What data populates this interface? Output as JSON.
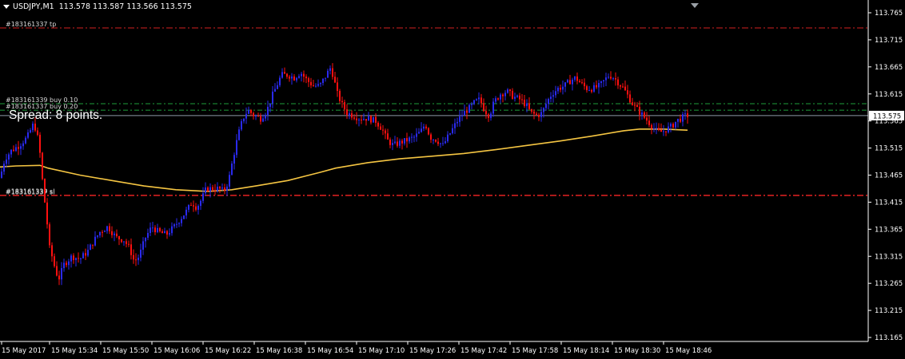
{
  "header": {
    "symbol": "USDJPY,M1",
    "quote": "113.578 113.587 113.566 113.575"
  },
  "spread_text": "Spread: 8 points.",
  "chart_data": {
    "type": "candlestick",
    "symbol": "USDJPY",
    "timeframe": "M1",
    "ylim": [
      113.165,
      113.765
    ],
    "y_ticks": [
      "113.765",
      "113.715",
      "113.665",
      "113.615",
      "113.565",
      "113.515",
      "113.465",
      "113.415",
      "113.365",
      "113.315",
      "113.265",
      "113.215",
      "113.165"
    ],
    "x_ticks": [
      "15 May 2017",
      "15 May 15:34",
      "15 May 15:50",
      "15 May 16:06",
      "15 May 16:22",
      "15 May 16:38",
      "15 May 16:54",
      "15 May 17:10",
      "15 May 17:26",
      "15 May 17:42",
      "15 May 17:58",
      "15 May 18:14",
      "15 May 18:30",
      "15 May 18:46"
    ],
    "current_price": "113.575",
    "colors": {
      "up": "#2a2af0",
      "down": "#ff1010",
      "ma": "#f5c542",
      "tp_sl": "#d42020",
      "order_line": "#1e9e3a",
      "price_line": "#8c99a6",
      "axis": "#ffffff"
    },
    "levels": [
      {
        "label": "#183161337 tp",
        "price": 113.737,
        "kind": "tp"
      },
      {
        "label": "#183161339 buy 0.10",
        "price": 113.597,
        "kind": "order"
      },
      {
        "label": "#183161337 buy 0.20",
        "price": 113.585,
        "kind": "order"
      },
      {
        "label": "#183161339 sl",
        "price": 113.428,
        "kind": "sl"
      },
      {
        "label": "#183161337 sl",
        "price": 113.427,
        "kind": "sl"
      }
    ],
    "price_path": [
      [
        0,
        113.46
      ],
      [
        6,
        113.495
      ],
      [
        14,
        113.51
      ],
      [
        24,
        113.52
      ],
      [
        34,
        113.535
      ],
      [
        42,
        113.56
      ],
      [
        46,
        113.545
      ],
      [
        50,
        113.505
      ],
      [
        54,
        113.44
      ],
      [
        58,
        113.39
      ],
      [
        62,
        113.33
      ],
      [
        66,
        113.31
      ],
      [
        70,
        113.285
      ],
      [
        74,
        113.275
      ],
      [
        80,
        113.3
      ],
      [
        90,
        113.315
      ],
      [
        100,
        113.31
      ],
      [
        110,
        113.325
      ],
      [
        118,
        113.345
      ],
      [
        125,
        113.36
      ],
      [
        135,
        113.37
      ],
      [
        145,
        113.35
      ],
      [
        155,
        113.345
      ],
      [
        162,
        113.33
      ],
      [
        168,
        113.305
      ],
      [
        174,
        113.315
      ],
      [
        182,
        113.35
      ],
      [
        190,
        113.37
      ],
      [
        198,
        113.36
      ],
      [
        208,
        113.355
      ],
      [
        218,
        113.37
      ],
      [
        226,
        113.385
      ],
      [
        234,
        113.4
      ],
      [
        240,
        113.415
      ],
      [
        246,
        113.405
      ],
      [
        252,
        113.42
      ],
      [
        258,
        113.44
      ],
      [
        266,
        113.44
      ],
      [
        274,
        113.44
      ],
      [
        280,
        113.435
      ],
      [
        286,
        113.455
      ],
      [
        292,
        113.5
      ],
      [
        298,
        113.54
      ],
      [
        304,
        113.57
      ],
      [
        310,
        113.585
      ],
      [
        318,
        113.575
      ],
      [
        326,
        113.57
      ],
      [
        334,
        113.585
      ],
      [
        340,
        113.61
      ],
      [
        346,
        113.63
      ],
      [
        352,
        113.65
      ],
      [
        360,
        113.65
      ],
      [
        368,
        113.645
      ],
      [
        376,
        113.655
      ],
      [
        384,
        113.64
      ],
      [
        392,
        113.63
      ],
      [
        400,
        113.63
      ],
      [
        408,
        113.65
      ],
      [
        414,
        113.665
      ],
      [
        418,
        113.64
      ],
      [
        422,
        113.615
      ],
      [
        428,
        113.595
      ],
      [
        434,
        113.58
      ],
      [
        442,
        113.575
      ],
      [
        450,
        113.57
      ],
      [
        460,
        113.57
      ],
      [
        470,
        113.565
      ],
      [
        478,
        113.55
      ],
      [
        484,
        113.53
      ],
      [
        492,
        113.52
      ],
      [
        500,
        113.525
      ],
      [
        510,
        113.53
      ],
      [
        518,
        113.535
      ],
      [
        526,
        113.545
      ],
      [
        532,
        113.56
      ],
      [
        538,
        113.535
      ],
      [
        546,
        113.53
      ],
      [
        554,
        113.52
      ],
      [
        560,
        113.535
      ],
      [
        566,
        113.55
      ],
      [
        572,
        113.565
      ],
      [
        580,
        113.58
      ],
      [
        588,
        113.59
      ],
      [
        594,
        113.6
      ],
      [
        600,
        113.605
      ],
      [
        606,
        113.585
      ],
      [
        612,
        113.575
      ],
      [
        618,
        113.6
      ],
      [
        626,
        113.615
      ],
      [
        634,
        113.62
      ],
      [
        642,
        113.61
      ],
      [
        650,
        113.605
      ],
      [
        658,
        113.595
      ],
      [
        664,
        113.58
      ],
      [
        672,
        113.575
      ],
      [
        678,
        113.58
      ],
      [
        684,
        113.6
      ],
      [
        690,
        113.615
      ],
      [
        698,
        113.625
      ],
      [
        706,
        113.63
      ],
      [
        714,
        113.64
      ],
      [
        720,
        113.645
      ],
      [
        726,
        113.635
      ],
      [
        734,
        113.625
      ],
      [
        742,
        113.625
      ],
      [
        750,
        113.63
      ],
      [
        756,
        113.64
      ],
      [
        762,
        113.65
      ],
      [
        768,
        113.645
      ],
      [
        774,
        113.635
      ],
      [
        780,
        113.625
      ],
      [
        786,
        113.61
      ],
      [
        792,
        113.595
      ],
      [
        798,
        113.585
      ],
      [
        804,
        113.575
      ],
      [
        810,
        113.565
      ],
      [
        816,
        113.555
      ],
      [
        822,
        113.545
      ],
      [
        828,
        113.545
      ],
      [
        834,
        113.55
      ],
      [
        840,
        113.555
      ],
      [
        846,
        113.565
      ],
      [
        852,
        113.57
      ],
      [
        858,
        113.575
      ],
      [
        860,
        113.575
      ]
    ],
    "ma_path": [
      [
        0,
        113.48
      ],
      [
        20,
        113.482
      ],
      [
        50,
        113.483
      ],
      [
        60,
        113.478
      ],
      [
        100,
        113.465
      ],
      [
        140,
        113.455
      ],
      [
        180,
        113.445
      ],
      [
        220,
        113.438
      ],
      [
        260,
        113.435
      ],
      [
        290,
        113.438
      ],
      [
        320,
        113.445
      ],
      [
        360,
        113.455
      ],
      [
        400,
        113.47
      ],
      [
        420,
        113.478
      ],
      [
        460,
        113.488
      ],
      [
        500,
        113.495
      ],
      [
        540,
        113.5
      ],
      [
        580,
        113.505
      ],
      [
        620,
        113.512
      ],
      [
        660,
        113.52
      ],
      [
        700,
        113.528
      ],
      [
        740,
        113.537
      ],
      [
        780,
        113.547
      ],
      [
        800,
        113.55
      ],
      [
        830,
        113.55
      ],
      [
        860,
        113.548
      ]
    ]
  }
}
